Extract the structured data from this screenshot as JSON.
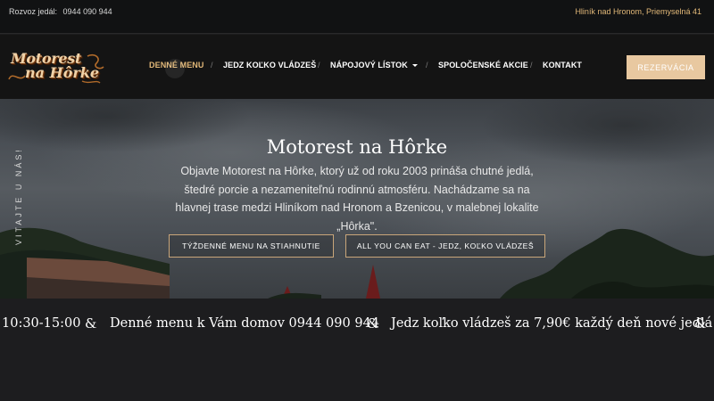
{
  "topbar": {
    "delivery_label": "Rozvoz jedál:",
    "delivery_phone": "0944 090 944",
    "address": "Hliník nad Hronom, Priemyselná 41"
  },
  "logo": {
    "line1": "Motorest",
    "line2": "na Hôrke"
  },
  "nav": {
    "items": [
      {
        "label": "DENNÉ MENU",
        "active": true
      },
      {
        "label": "JEDZ KOĽKO VLÁDZEŠ"
      },
      {
        "label": "NÁPOJOVÝ LÍSTOK",
        "dropdown": true
      },
      {
        "label": "SPOLOČENSKÉ AKCIE"
      },
      {
        "label": "KONTAKT"
      }
    ],
    "separator": "/",
    "reserve_label": "REZERVÁCIA"
  },
  "hero": {
    "side_text": "VITAJTE U NÁS!",
    "title": "Motorest na Hôrke",
    "text": "Objavte Motorest na Hôrke, ktorý už od roku 2003 prináša chutné jedlá, štedré porcie a nezameniteľnú rodinnú atmosféru. Nachádzame sa na hlavnej trase medzi Hliníkom nad Hronom a Bzenicou, v malebnej lokalite „Hôrka\".",
    "button_weekly": "TÝŽDENNÉ MENU NA STIAHNUTIE",
    "button_aycte": "ALL YOU CAN EAT - JEDZ, KOĽKO VLÁDZEŠ"
  },
  "ticker": {
    "items": [
      "10:30-15:00",
      "Denné menu k Vám domov 0944 090 944",
      "Jedz koľko vládzeš za 7,90€ každý deň nové jedlá"
    ],
    "separator": "&"
  },
  "colors": {
    "accent": "#e2b878",
    "button_fill": "#e8c8a0",
    "background": "#1c1c1e"
  }
}
